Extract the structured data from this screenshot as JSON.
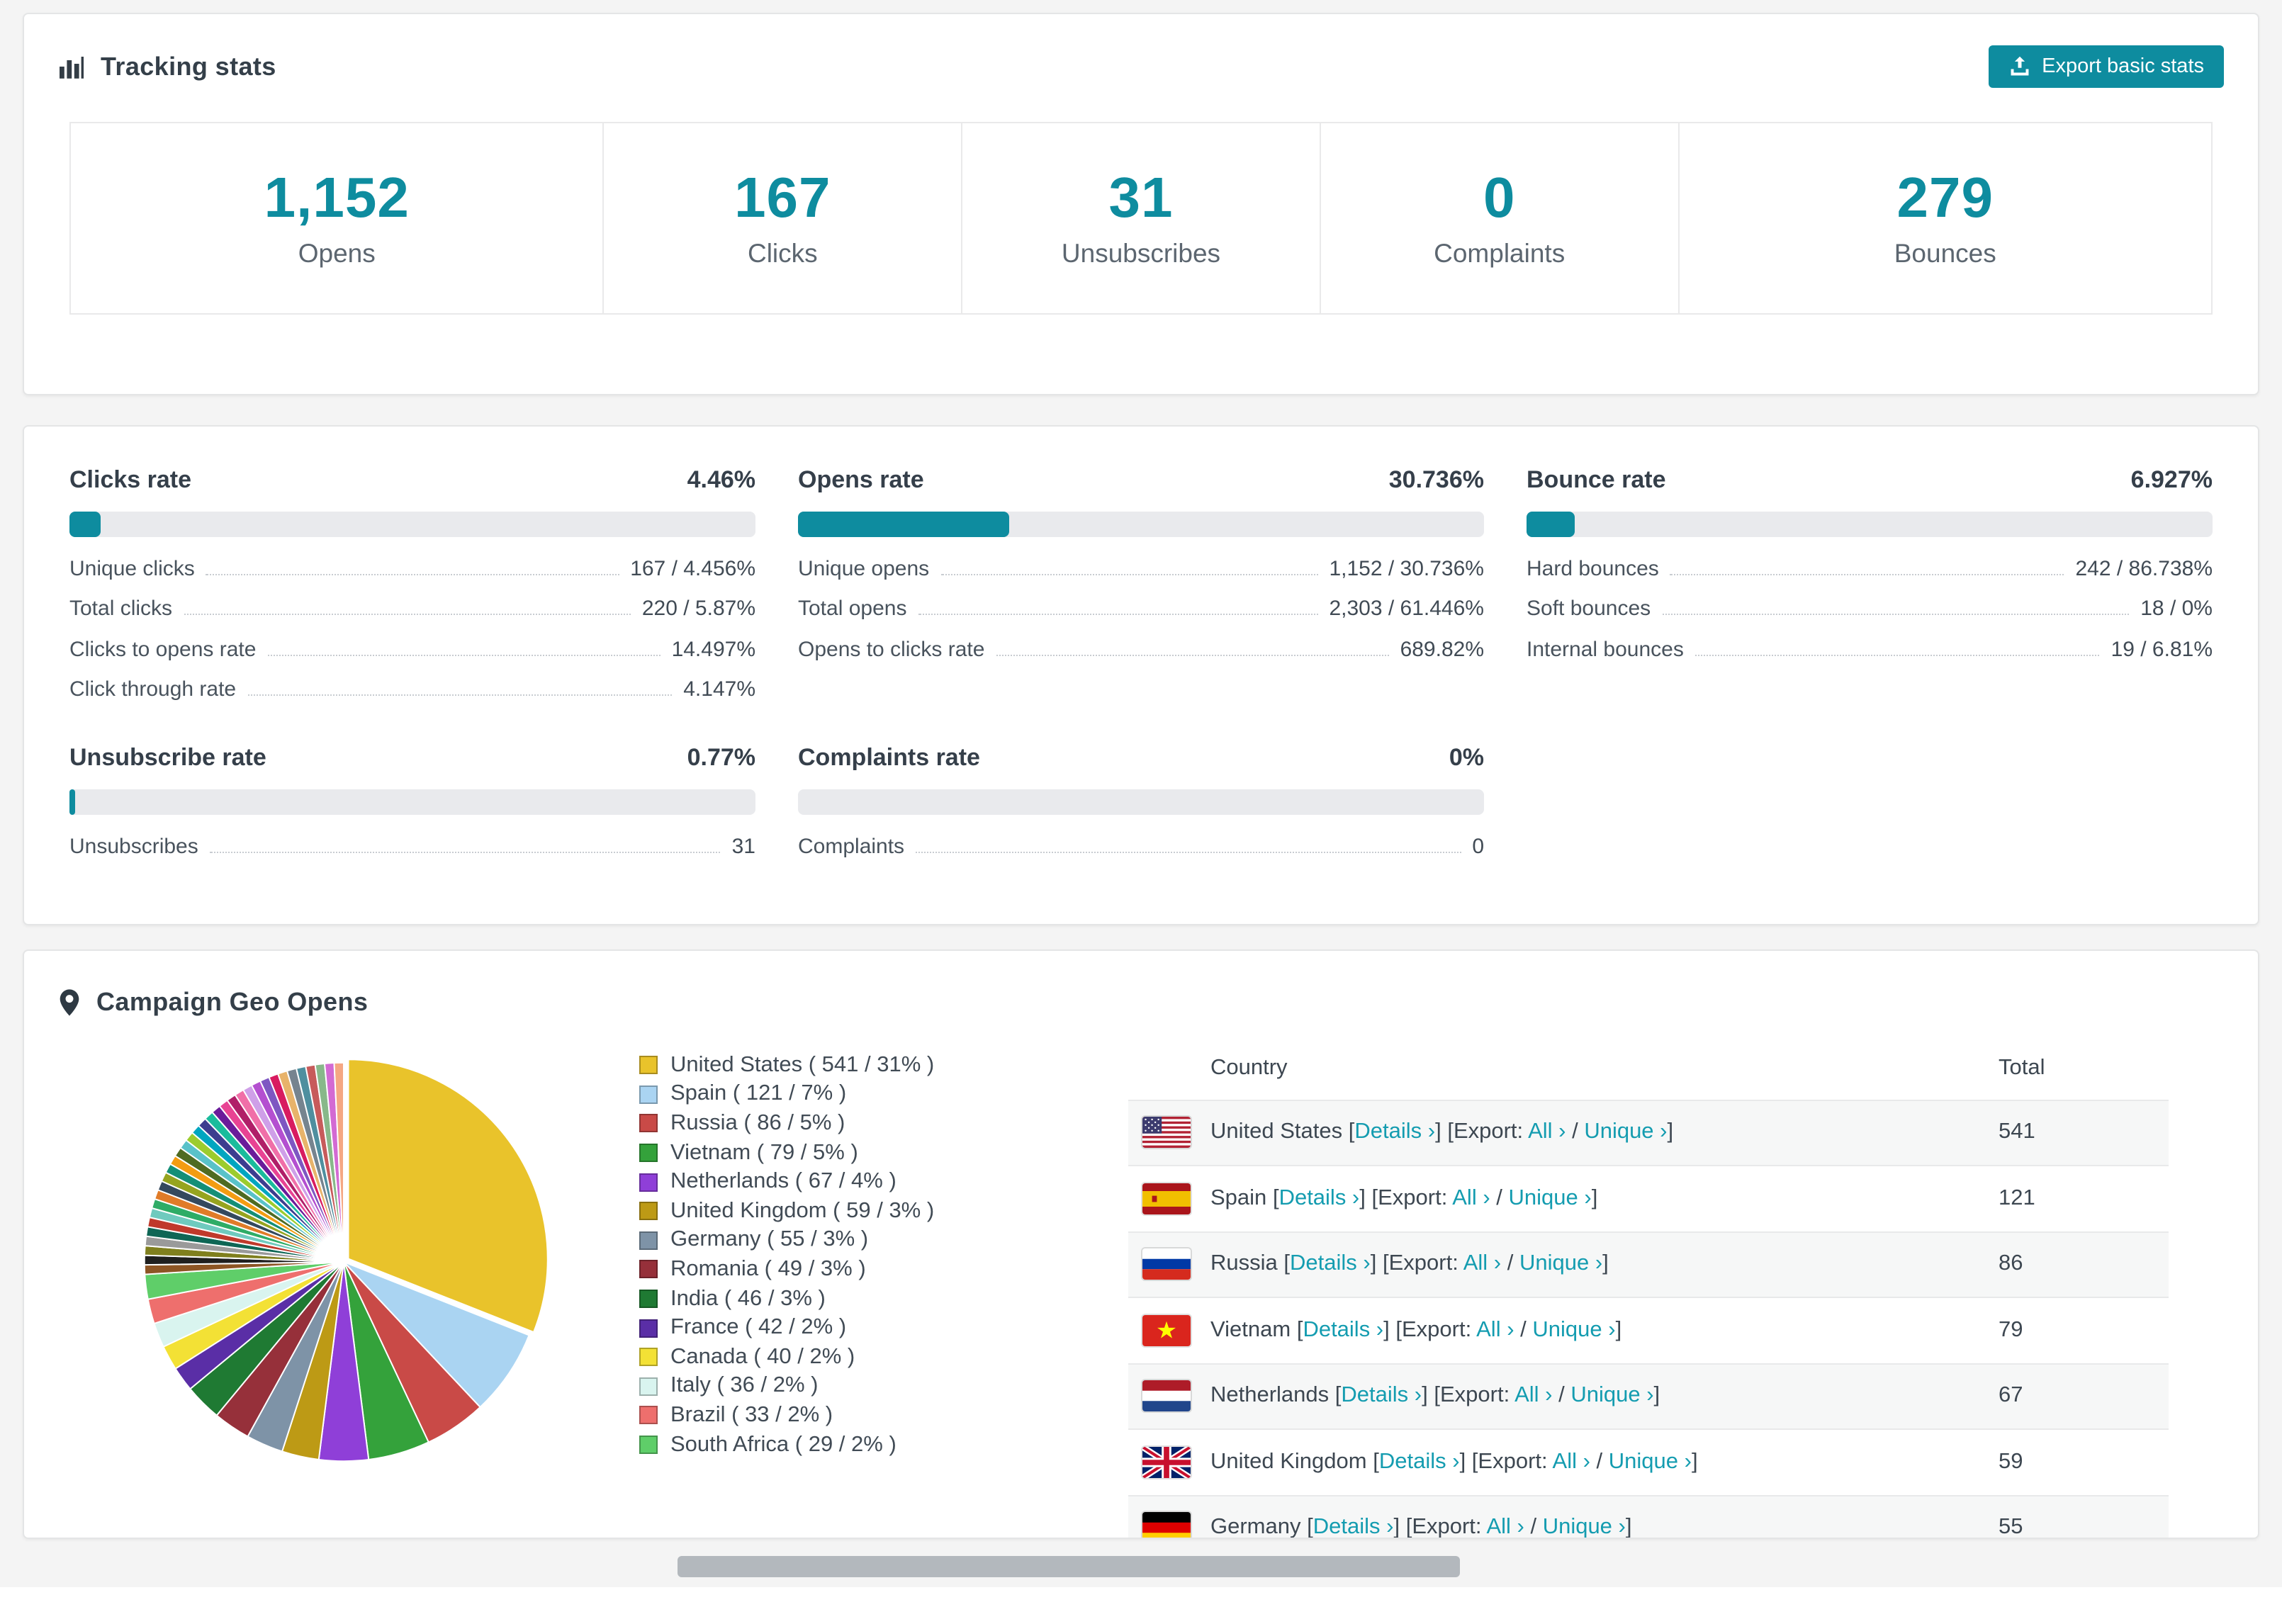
{
  "accent": "#0e8c9f",
  "link_color": "#149cb0",
  "tracking": {
    "title": "Tracking stats",
    "export_button": "Export basic stats",
    "stats": [
      {
        "value": "1,152",
        "label": "Opens"
      },
      {
        "value": "167",
        "label": "Clicks"
      },
      {
        "value": "31",
        "label": "Unsubscribes"
      },
      {
        "value": "0",
        "label": "Complaints"
      },
      {
        "value": "279",
        "label": "Bounces"
      }
    ]
  },
  "rates": [
    {
      "title": "Clicks rate",
      "value": "4.46%",
      "pct": 4.46,
      "rows": [
        [
          "Unique clicks",
          "167 / 4.456%"
        ],
        [
          "Total clicks",
          "220 / 5.87%"
        ],
        [
          "Clicks to opens rate",
          "14.497%"
        ],
        [
          "Click through rate",
          "4.147%"
        ]
      ]
    },
    {
      "title": "Opens rate",
      "value": "30.736%",
      "pct": 30.736,
      "rows": [
        [
          "Unique opens",
          "1,152 / 30.736%"
        ],
        [
          "Total opens",
          "2,303 / 61.446%"
        ],
        [
          "Opens to clicks rate",
          "689.82%"
        ]
      ]
    },
    {
      "title": "Bounce rate",
      "value": "6.927%",
      "pct": 6.927,
      "rows": [
        [
          "Hard bounces",
          "242 / 86.738%"
        ],
        [
          "Soft bounces",
          "18 / 0%"
        ],
        [
          "Internal bounces",
          "19 / 6.81%"
        ]
      ]
    },
    {
      "title": "Unsubscribe rate",
      "value": "0.77%",
      "pct": 0.77,
      "rows": [
        [
          "Unsubscribes",
          "31"
        ]
      ]
    },
    {
      "title": "Complaints rate",
      "value": "0%",
      "pct": 0,
      "rows": [
        [
          "Complaints",
          "0"
        ]
      ]
    }
  ],
  "geo": {
    "title": "Campaign Geo Opens",
    "table": {
      "headers": {
        "country": "Country",
        "total": "Total"
      },
      "links": {
        "details": "Details ›",
        "export_prefix": "Export:",
        "all": "All ›",
        "unique": "Unique ›"
      },
      "rows": [
        {
          "country": "United States",
          "flag": "us",
          "total": "541"
        },
        {
          "country": "Spain",
          "flag": "es",
          "total": "121"
        },
        {
          "country": "Russia",
          "flag": "ru",
          "total": "86"
        },
        {
          "country": "Vietnam",
          "flag": "vn",
          "total": "79"
        },
        {
          "country": "Netherlands",
          "flag": "nl",
          "total": "67"
        },
        {
          "country": "United Kingdom",
          "flag": "gb",
          "total": "59"
        },
        {
          "country": "Germany",
          "flag": "de",
          "total": "55"
        }
      ]
    }
  },
  "chart_data": {
    "type": "pie",
    "title": "Campaign Geo Opens",
    "unit": "opens",
    "legend_position": "right",
    "slices": [
      {
        "label": "United States",
        "count": 541,
        "pct": 31,
        "color": "#e9c32b"
      },
      {
        "label": "Spain",
        "count": 121,
        "pct": 7,
        "color": "#aad4f2"
      },
      {
        "label": "Russia",
        "count": 86,
        "pct": 5,
        "color": "#c94a47"
      },
      {
        "label": "Vietnam",
        "count": 79,
        "pct": 5,
        "color": "#34a23b"
      },
      {
        "label": "Netherlands",
        "count": 67,
        "pct": 4,
        "color": "#8f3fd8"
      },
      {
        "label": "United Kingdom",
        "count": 59,
        "pct": 3,
        "color": "#bd9a15"
      },
      {
        "label": "Germany",
        "count": 55,
        "pct": 3,
        "color": "#7e93a7"
      },
      {
        "label": "Romania",
        "count": 49,
        "pct": 3,
        "color": "#96303a"
      },
      {
        "label": "India",
        "count": 46,
        "pct": 3,
        "color": "#1f7a33"
      },
      {
        "label": "France",
        "count": 42,
        "pct": 2,
        "color": "#5a2ea6"
      },
      {
        "label": "Canada",
        "count": 40,
        "pct": 2,
        "color": "#f3e135"
      },
      {
        "label": "Italy",
        "count": 36,
        "pct": 2,
        "color": "#d9f4ef"
      },
      {
        "label": "Brazil",
        "count": 33,
        "pct": 2,
        "color": "#ee6f6d"
      },
      {
        "label": "South Africa",
        "count": 29,
        "pct": 2,
        "color": "#5fce69"
      }
    ],
    "others_colors": [
      "#8d5524",
      "#1f1f1f",
      "#7f7f1e",
      "#9a9a9a",
      "#0e6655",
      "#c0392b",
      "#6fcabe",
      "#2eac66",
      "#e07b28",
      "#34495e",
      "#96a41f",
      "#148f77",
      "#f39c12",
      "#4f6b22",
      "#59c2c9",
      "#9ccc2e",
      "#00a6c0",
      "#3d3d8f",
      "#1abc9c",
      "#6a1b9a",
      "#e84393",
      "#b01f68",
      "#f06fa8",
      "#cf9fe8",
      "#b44fd0",
      "#7e57c2",
      "#d81b60",
      "#e8b36a",
      "#76848f",
      "#4f8f9f",
      "#c75b5b",
      "#88b88a",
      "#d36ad3",
      "#f5a783"
    ]
  }
}
